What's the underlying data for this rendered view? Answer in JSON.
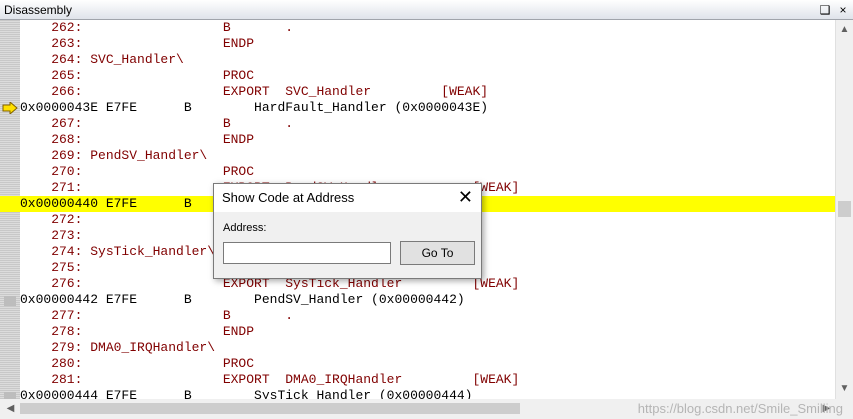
{
  "window": {
    "title": "Disassembly",
    "pin_glyph": "❑",
    "close_glyph": "×"
  },
  "lines": [
    {
      "text": "    262:                  B       .",
      "kind": "src"
    },
    {
      "text": "    263:                  ENDP",
      "kind": "src"
    },
    {
      "text": "    264: SVC_Handler\\",
      "kind": "src"
    },
    {
      "text": "    265:                  PROC",
      "kind": "src"
    },
    {
      "text": "    266:                  EXPORT  SVC_Handler         [WEAK]",
      "kind": "src"
    },
    {
      "text": "0x0000043E E7FE      B        HardFault_Handler (0x0000043E)",
      "kind": "asm",
      "arrow": true
    },
    {
      "text": "    267:                  B       .",
      "kind": "src"
    },
    {
      "text": "    268:                  ENDP",
      "kind": "src"
    },
    {
      "text": "    269: PendSV_Handler\\",
      "kind": "src"
    },
    {
      "text": "    270:                  PROC",
      "kind": "src"
    },
    {
      "text": "    271:                  EXPORT  PendSV_Handler          [WEAK]",
      "kind": "src"
    },
    {
      "text": "0x00000440 E7FE      B        PendSV_Handler (0x00000440)",
      "kind": "asm",
      "highlight": true
    },
    {
      "text": "    272:                  B       .",
      "kind": "src"
    },
    {
      "text": "    273:                  ENDP",
      "kind": "src"
    },
    {
      "text": "    274: SysTick_Handler\\",
      "kind": "src"
    },
    {
      "text": "    275:                  PROC",
      "kind": "src"
    },
    {
      "text": "    276:                  EXPORT  SysTick_Handler         [WEAK]",
      "kind": "src"
    },
    {
      "text": "0x00000442 E7FE      B        PendSV_Handler (0x00000442)",
      "kind": "asm",
      "marker": true
    },
    {
      "text": "    277:                  B       .",
      "kind": "src"
    },
    {
      "text": "    278:                  ENDP",
      "kind": "src"
    },
    {
      "text": "    279: DMA0_IRQHandler\\",
      "kind": "src"
    },
    {
      "text": "    280:                  PROC",
      "kind": "src"
    },
    {
      "text": "    281:                  EXPORT  DMA0_IRQHandler         [WEAK]",
      "kind": "src"
    },
    {
      "text": "0x00000444 E7FE      B        SysTick_Handler (0x00000444)",
      "kind": "asm",
      "marker": true
    }
  ],
  "dialog": {
    "title": "Show Code at Address",
    "close_glyph": "✕",
    "address_label": "Address:",
    "address_value": "",
    "go_button": "Go To"
  },
  "scrollbar": {
    "up": "▲",
    "down": "▼",
    "left": "◀",
    "right": "▶"
  },
  "watermark": "https://blog.csdn.net/Smile_Smilling"
}
